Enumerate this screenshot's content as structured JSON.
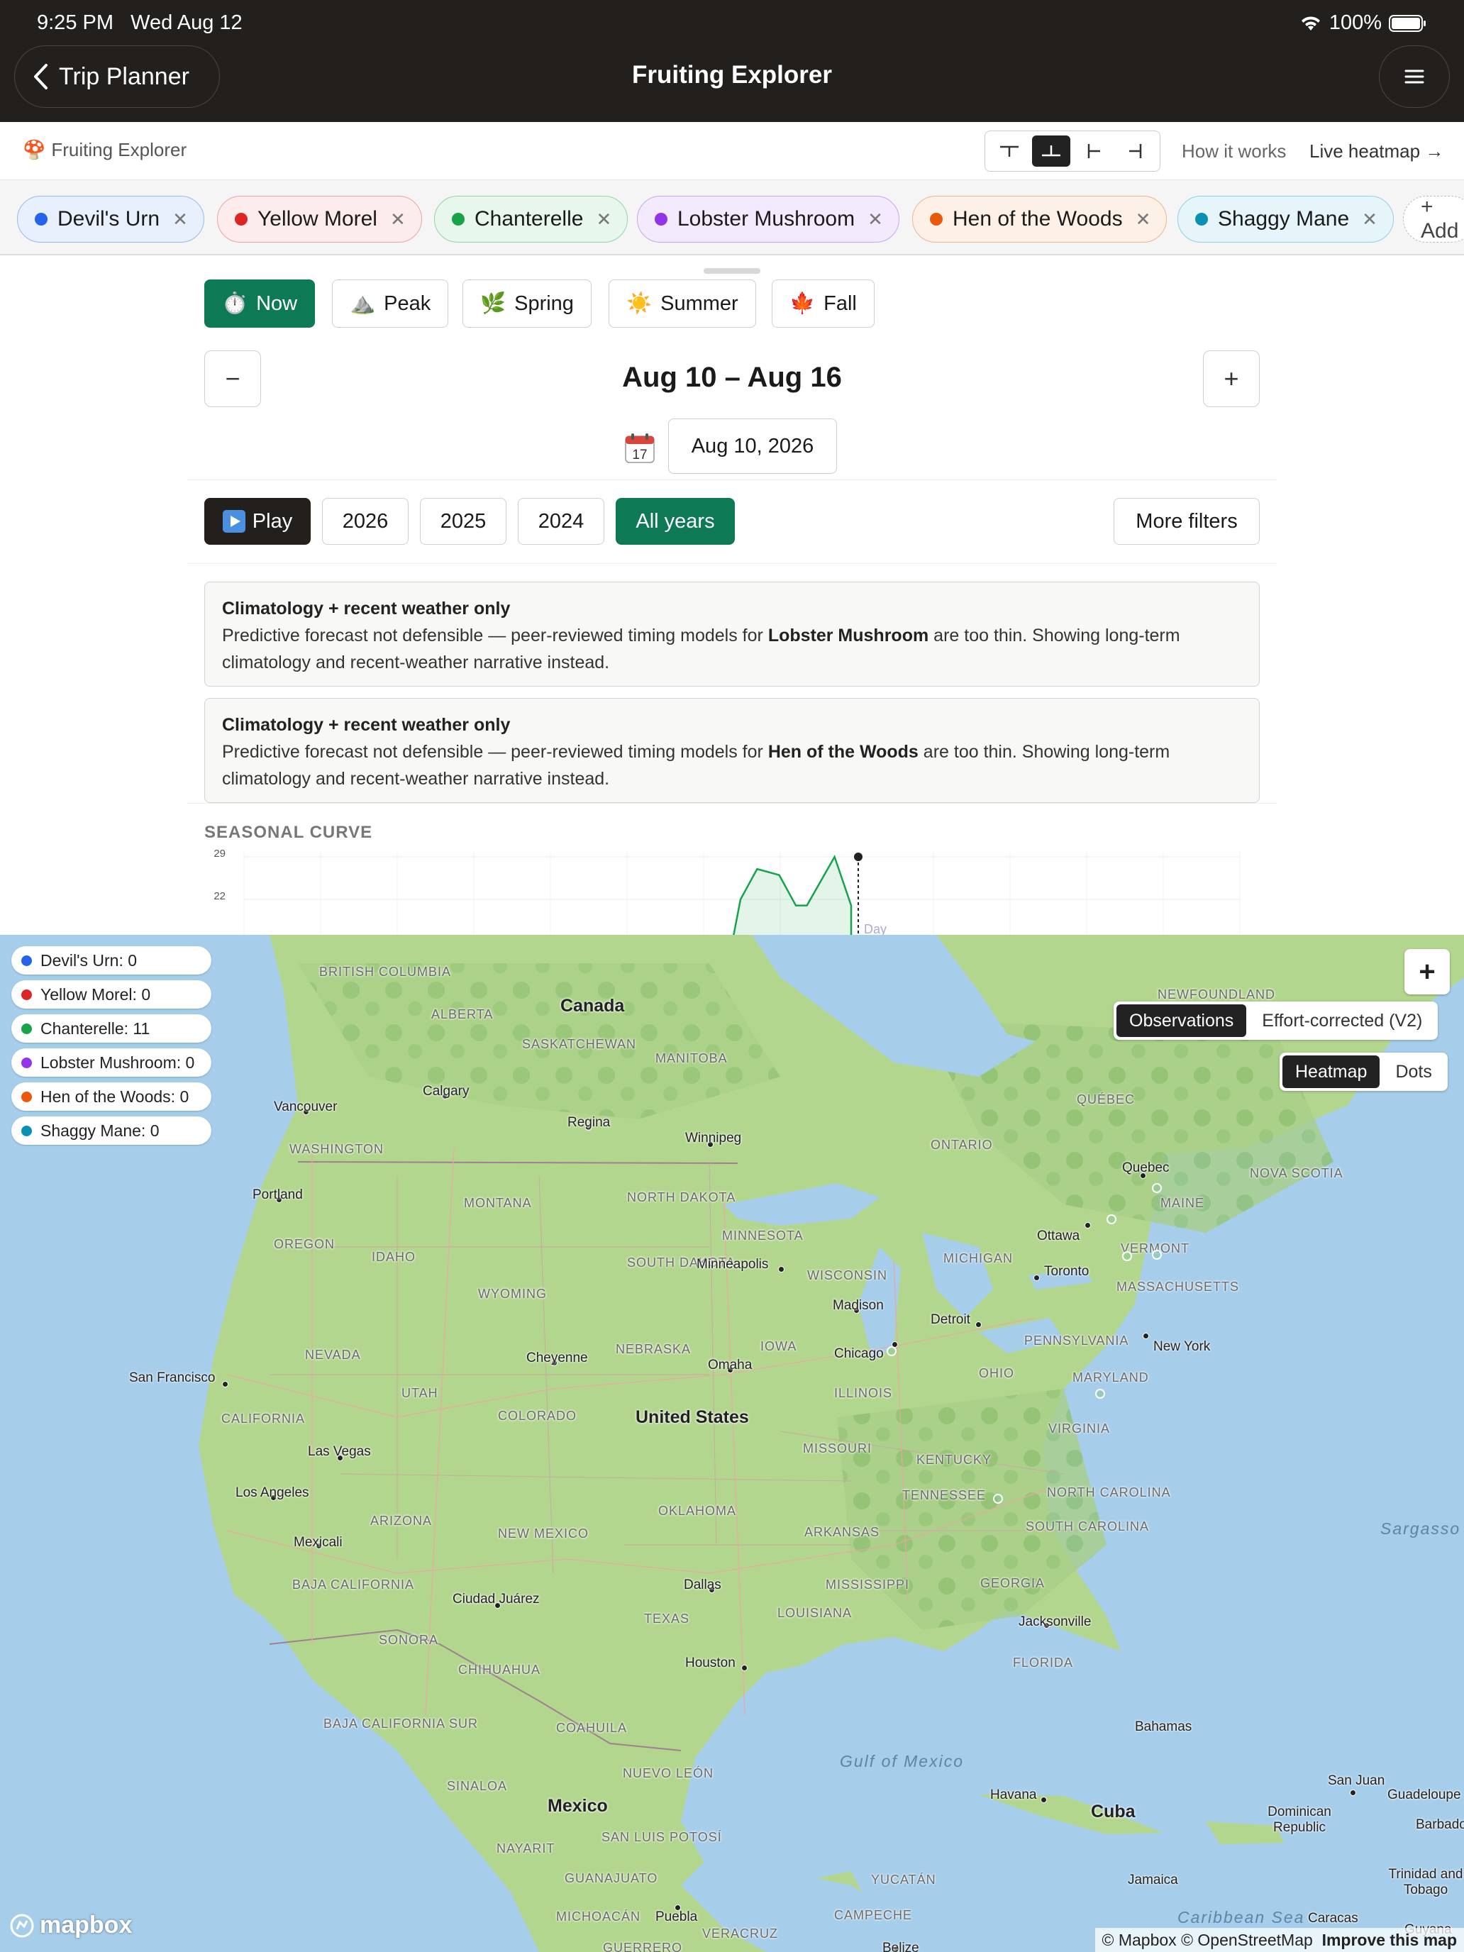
{
  "status_bar": {
    "time": "9:25 PM",
    "date": "Wed Aug 12",
    "battery": "100%"
  },
  "nav": {
    "back_label": "Trip Planner",
    "title": "Fruiting Explorer"
  },
  "toolbar": {
    "brand": "Fruiting Explorer",
    "how_it_works": "How it works",
    "live_heatmap": "Live heatmap →"
  },
  "species_chips": [
    {
      "name": "Devil's Urn",
      "color": "#2563eb",
      "bg": "#e8f0fe",
      "border": "#9bb8ee"
    },
    {
      "name": "Yellow Morel",
      "color": "#dc2626",
      "bg": "#fdecec",
      "border": "#eea1a1"
    },
    {
      "name": "Chanterelle",
      "color": "#16a34a",
      "bg": "#e8f7ec",
      "border": "#98d2a8"
    },
    {
      "name": "Lobster Mushroom",
      "color": "#9333ea",
      "bg": "#f4eafd",
      "border": "#c9a3ee"
    },
    {
      "name": "Hen of the Woods",
      "color": "#ea580c",
      "bg": "#fdf0e6",
      "border": "#efb58e"
    },
    {
      "name": "Shaggy Mane",
      "color": "#0891b2",
      "bg": "#e6f5f9",
      "border": "#92cfdf"
    }
  ],
  "add_chip_label": "+ Add",
  "season_tabs": [
    {
      "icon": "⏱️",
      "label": "Now"
    },
    {
      "icon": "⛰️",
      "label": "Peak"
    },
    {
      "icon": "🌿",
      "label": "Spring"
    },
    {
      "icon": "☀️",
      "label": "Summer"
    },
    {
      "icon": "🍁",
      "label": "Fall"
    }
  ],
  "week_range": "Aug 10 – Aug 16",
  "prev_label": "−",
  "next_label": "+",
  "date_value": "Aug 10, 2026",
  "years": {
    "play": "Play",
    "y2026": "2026",
    "y2025": "2025",
    "y2024": "2024",
    "all": "All years",
    "more_filters": "More filters"
  },
  "notices": [
    {
      "title": "Climatology + recent weather only",
      "pre": "Predictive forecast not defensible — peer-reviewed timing models for ",
      "species": "Lobster Mushroom",
      "post": " are too thin. Showing long-term",
      "line2": "climatology and recent-weather narrative instead."
    },
    {
      "title": "Climatology + recent weather only",
      "pre": "Predictive forecast not defensible — peer-reviewed timing models for ",
      "species": "Hen of the Woods",
      "post": " are too thin. Showing long-term",
      "line2": "climatology and recent-weather narrative instead."
    }
  ],
  "seasonal_curve": {
    "label": "SEASONAL CURVE",
    "y_ticks": [
      "29",
      "22"
    ],
    "marker_label": "Day"
  },
  "chart_data": {
    "type": "line",
    "title": "SEASONAL CURVE",
    "ylabel": "",
    "y_ticks": [
      29,
      22
    ],
    "series": [
      {
        "name": "Chanterelle",
        "color": "#16a34a",
        "visible_points": [
          [
            0.0,
            22
          ],
          [
            0.15,
            27
          ],
          [
            0.35,
            26
          ],
          [
            0.5,
            21
          ],
          [
            0.6,
            21
          ],
          [
            0.85,
            29
          ],
          [
            1.0,
            21
          ]
        ]
      }
    ],
    "note": "Only the top portion of the curve is visible; remaining area hidden under the map."
  },
  "map_legend": [
    {
      "label": "Devil's Urn: 0",
      "color": "#2563eb"
    },
    {
      "label": "Yellow Morel: 0",
      "color": "#dc2626"
    },
    {
      "label": "Chanterelle: 11",
      "color": "#16a34a"
    },
    {
      "label": "Lobster Mushroom: 0",
      "color": "#9333ea"
    },
    {
      "label": "Hen of the Woods: 0",
      "color": "#ea580c"
    },
    {
      "label": "Shaggy Mane: 0",
      "color": "#0891b2"
    }
  ],
  "map_controls": {
    "observations": "Observations",
    "effort": "Effort-corrected (V2)",
    "heatmap": "Heatmap",
    "dots": "Dots",
    "zoom_in": "+"
  },
  "map_labels": {
    "countries": [
      "Canada",
      "United States",
      "Mexico",
      "Cuba"
    ],
    "provinces": [
      "BRITISH COLUMBIA",
      "ALBERTA",
      "SASKATCHEWAN",
      "MANITOBA",
      "ONTARIO",
      "QUÉBEC",
      "NEWFOUNDLAND",
      "NOVA SCOTIA",
      "WASHINGTON",
      "OREGON",
      "IDAHO",
      "MONTANA",
      "WYOMING",
      "NEVADA",
      "CALIFORNIA",
      "UTAH",
      "ARIZONA",
      "COLORADO",
      "NEW MEXICO",
      "NORTH DAKOTA",
      "SOUTH DAKOTA",
      "NEBRASKA",
      "MINNESOTA",
      "IOWA",
      "WISCONSIN",
      "MICHIGAN",
      "ILLINOIS",
      "MISSOURI",
      "OKLAHOMA",
      "TEXAS",
      "ARKANSAS",
      "LOUISIANA",
      "MISSISSIPPI",
      "TENNESSEE",
      "KENTUCKY",
      "OHIO",
      "PENNSYLVANIA",
      "VIRGINIA",
      "NORTH CAROLINA",
      "SOUTH CAROLINA",
      "GEORGIA",
      "FLORIDA",
      "MAINE",
      "VERMONT",
      "MASSACHUSETTS",
      "MARYLAND",
      "BAJA CALIFORNIA",
      "BAJA CALIFORNIA SUR",
      "SONORA",
      "CHIHUAHUA",
      "COAHUILA",
      "NUEVO LEÓN",
      "SINALOA",
      "SAN LUIS POTOSÍ",
      "NAYARIT",
      "GUANAJUATO",
      "MICHOACÁN",
      "YUCATÁN",
      "CAMPECHE",
      "VERACRUZ",
      "GUERRERO"
    ],
    "cities": [
      "Vancouver",
      "Calgary",
      "Regina",
      "Winnipeg",
      "Portland",
      "San Francisco",
      "Las Vegas",
      "Los Angeles",
      "Mexicali",
      "Cheyenne",
      "Omaha",
      "Minneapolis",
      "Madison",
      "Chicago",
      "Detroit",
      "Toronto",
      "Ottawa",
      "Quebec",
      "New York",
      "Dallas",
      "Houston",
      "Jacksonville",
      "Ciudad Juárez",
      "Havana",
      "Puebla",
      "Belize",
      "Bahamas",
      "San Juan",
      "Guadeloupe",
      "Barbados",
      "Trinidad and Tobago",
      "Jamaica",
      "Dominican Republic",
      "Guyana",
      "Caracas"
    ],
    "seas": [
      "Gulf of Mexico",
      "Sargasso Sea",
      "Caribbean Sea"
    ]
  },
  "map_attribution": {
    "text": "© Mapbox © OpenStreetMap",
    "improve": "Improve this map",
    "logo": "mapbox"
  }
}
